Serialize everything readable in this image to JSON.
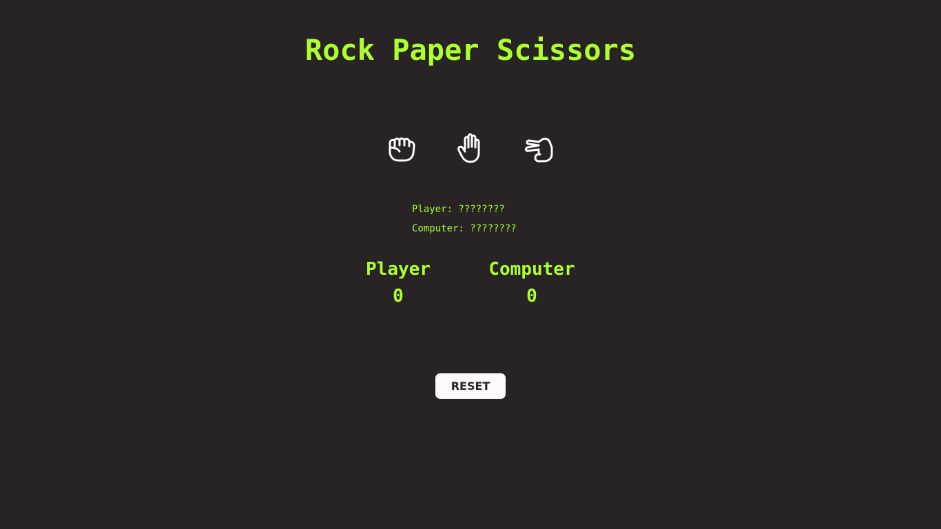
{
  "title": "Rock Paper Scissors",
  "choices": [
    {
      "name": "rock",
      "icon": "fist-rock-icon"
    },
    {
      "name": "paper",
      "icon": "open-hand-paper-icon"
    },
    {
      "name": "scissors",
      "icon": "hand-scissors-icon"
    }
  ],
  "picks": {
    "player": "Player: ????????",
    "computer": "Computer: ????????"
  },
  "scoreboard": {
    "player_label": "Player",
    "player_score": "0",
    "computer_label": "Computer",
    "computer_score": "0"
  },
  "reset_label": "RESET",
  "colors": {
    "background": "#282324",
    "accent": "#adff2f",
    "button_bg": "#fffafa",
    "icon": "#ffffff"
  }
}
